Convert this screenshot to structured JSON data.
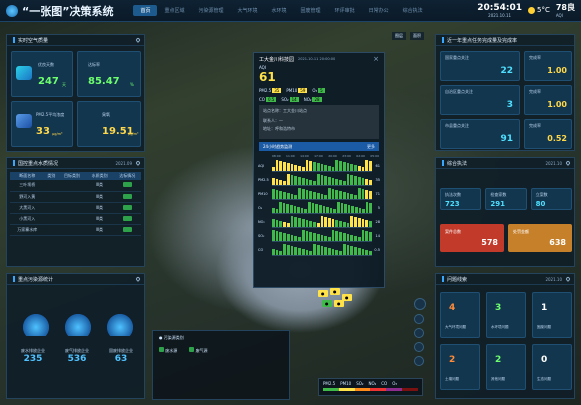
{
  "header": {
    "title": "“一张图”决策系统",
    "nav": [
      "首页",
      "重点区域",
      "污染源管理",
      "大气环境",
      "水环境",
      "固废管理",
      "环评审批",
      "日常办公",
      "综合执法"
    ],
    "active_nav": 0,
    "time": "20:54:01",
    "date": "2021.10.11",
    "weather_temp": "5°C",
    "aqi_top": {
      "value": "78良",
      "label": "AQI"
    }
  },
  "left_top": {
    "title": "实时空气质量",
    "cards": [
      {
        "label": "优良天数",
        "value": "247",
        "unit": "天"
      },
      {
        "label": "达标率",
        "value": "85.47",
        "unit": "%"
      },
      {
        "label": "PM2.5平均浓度",
        "value": "33",
        "unit": "μg/m³"
      },
      {
        "label": "臭氧",
        "value": "19.51",
        "unit": "μg/m³"
      }
    ]
  },
  "left_mid": {
    "title": "国控重点水质情况",
    "date": "2021.09",
    "columns": [
      "断面名称",
      "类别",
      "目标类别",
      "水质类别",
      "达标情况"
    ],
    "rows": [
      [
        "三叶坝桥",
        "",
        "",
        "Ⅲ类",
        ""
      ],
      [
        "野河入黄",
        "",
        "",
        "Ⅲ类",
        ""
      ],
      [
        "大黑河入",
        "",
        "",
        "Ⅲ类",
        ""
      ],
      [
        "小黑河入",
        "",
        "",
        "Ⅲ类",
        ""
      ],
      [
        "万家寨水库",
        "",
        "",
        "Ⅲ类",
        ""
      ]
    ]
  },
  "left_bottom": {
    "title": "重点污染源统计",
    "items": [
      {
        "label": "废水排放企业",
        "value": "235"
      },
      {
        "label": "废气排放企业",
        "value": "536"
      },
      {
        "label": "固废排放企业",
        "value": "63"
      }
    ]
  },
  "map_legend": {
    "title": "污染源类别",
    "items": [
      "废水源",
      "废气源"
    ]
  },
  "map_tools": [
    "图层",
    "面积"
  ],
  "popup": {
    "title": "工大金川科技园",
    "timestamp": "2021-10-11 20:00:00",
    "aqi_label": "AQI",
    "aqi_value": "61",
    "pollutants_row1": [
      {
        "name": "PM2.5",
        "val": "35"
      },
      {
        "name": "PM10",
        "val": "59"
      },
      {
        "name": "O₃",
        "val": "5"
      }
    ],
    "pollutants_row2": [
      {
        "name": "CO",
        "val": "0.5"
      },
      {
        "name": "SO₂",
        "val": "14"
      },
      {
        "name": "NO₂",
        "val": "28"
      }
    ],
    "info": [
      {
        "k": "站点名称",
        "v": "工大金川站点"
      },
      {
        "k": "联系人",
        "v": "—"
      },
      {
        "k": "地址",
        "v": "呼和浩特市"
      }
    ],
    "tab_label": "24小时趋势监测",
    "more_label": "更多",
    "hours": [
      "08:00",
      "11:00",
      "14:00",
      "17:00",
      "20:00",
      "23:00",
      "02:00",
      "05:00",
      "08:00"
    ],
    "series": [
      {
        "name": "AQI",
        "last": "61"
      },
      {
        "name": "PM2.5",
        "last": "35"
      },
      {
        "name": "PM10",
        "last": "71"
      },
      {
        "name": "O₃",
        "last": "5"
      },
      {
        "name": "NO₂",
        "last": "28"
      },
      {
        "name": "SO₂",
        "last": "14"
      },
      {
        "name": "CO",
        "last": "0.5"
      }
    ]
  },
  "right_top": {
    "title": "近一年重点任务完成量及完成率",
    "rows": [
      {
        "label": "国家重点关注",
        "value": "22",
        "rate_label": "完成率",
        "rate": "1.00"
      },
      {
        "label": "自治区重点关注",
        "value": "3",
        "rate_label": "完成率",
        "rate": "1.00"
      },
      {
        "label": "市县重点关注",
        "value": "91",
        "rate_label": "完成率",
        "rate": "0.52"
      }
    ]
  },
  "right_mid": {
    "title": "综合执法",
    "date": "2021.10",
    "stats": [
      {
        "label": "执法次数",
        "value": "723"
      },
      {
        "label": "检查家数",
        "value": "291"
      },
      {
        "label": "立案数",
        "value": "80"
      }
    ],
    "badges": [
      {
        "label": "案件总数",
        "value": "578"
      },
      {
        "label": "处罚金额",
        "value": "638"
      }
    ]
  },
  "right_bottom": {
    "title": "问题线索",
    "date": "2021.10",
    "items": [
      {
        "value": "4",
        "label": "大气环境问题"
      },
      {
        "value": "3",
        "label": "水环境问题"
      },
      {
        "value": "1",
        "label": "固废问题"
      },
      {
        "value": "2",
        "label": "土壤问题"
      },
      {
        "value": "2",
        "label": "其他问题"
      },
      {
        "value": "0",
        "label": "生态问题"
      }
    ]
  },
  "bottom_legend": {
    "items": [
      "PM2.5",
      "PM10",
      "SO₂",
      "NO₂",
      "CO",
      "O₃"
    ]
  },
  "colors": {
    "accent": "#3aa7ff",
    "good": "#3fb94a",
    "moderate": "#ffe24a",
    "warn": "#d9412f",
    "orange": "#d6872e"
  }
}
